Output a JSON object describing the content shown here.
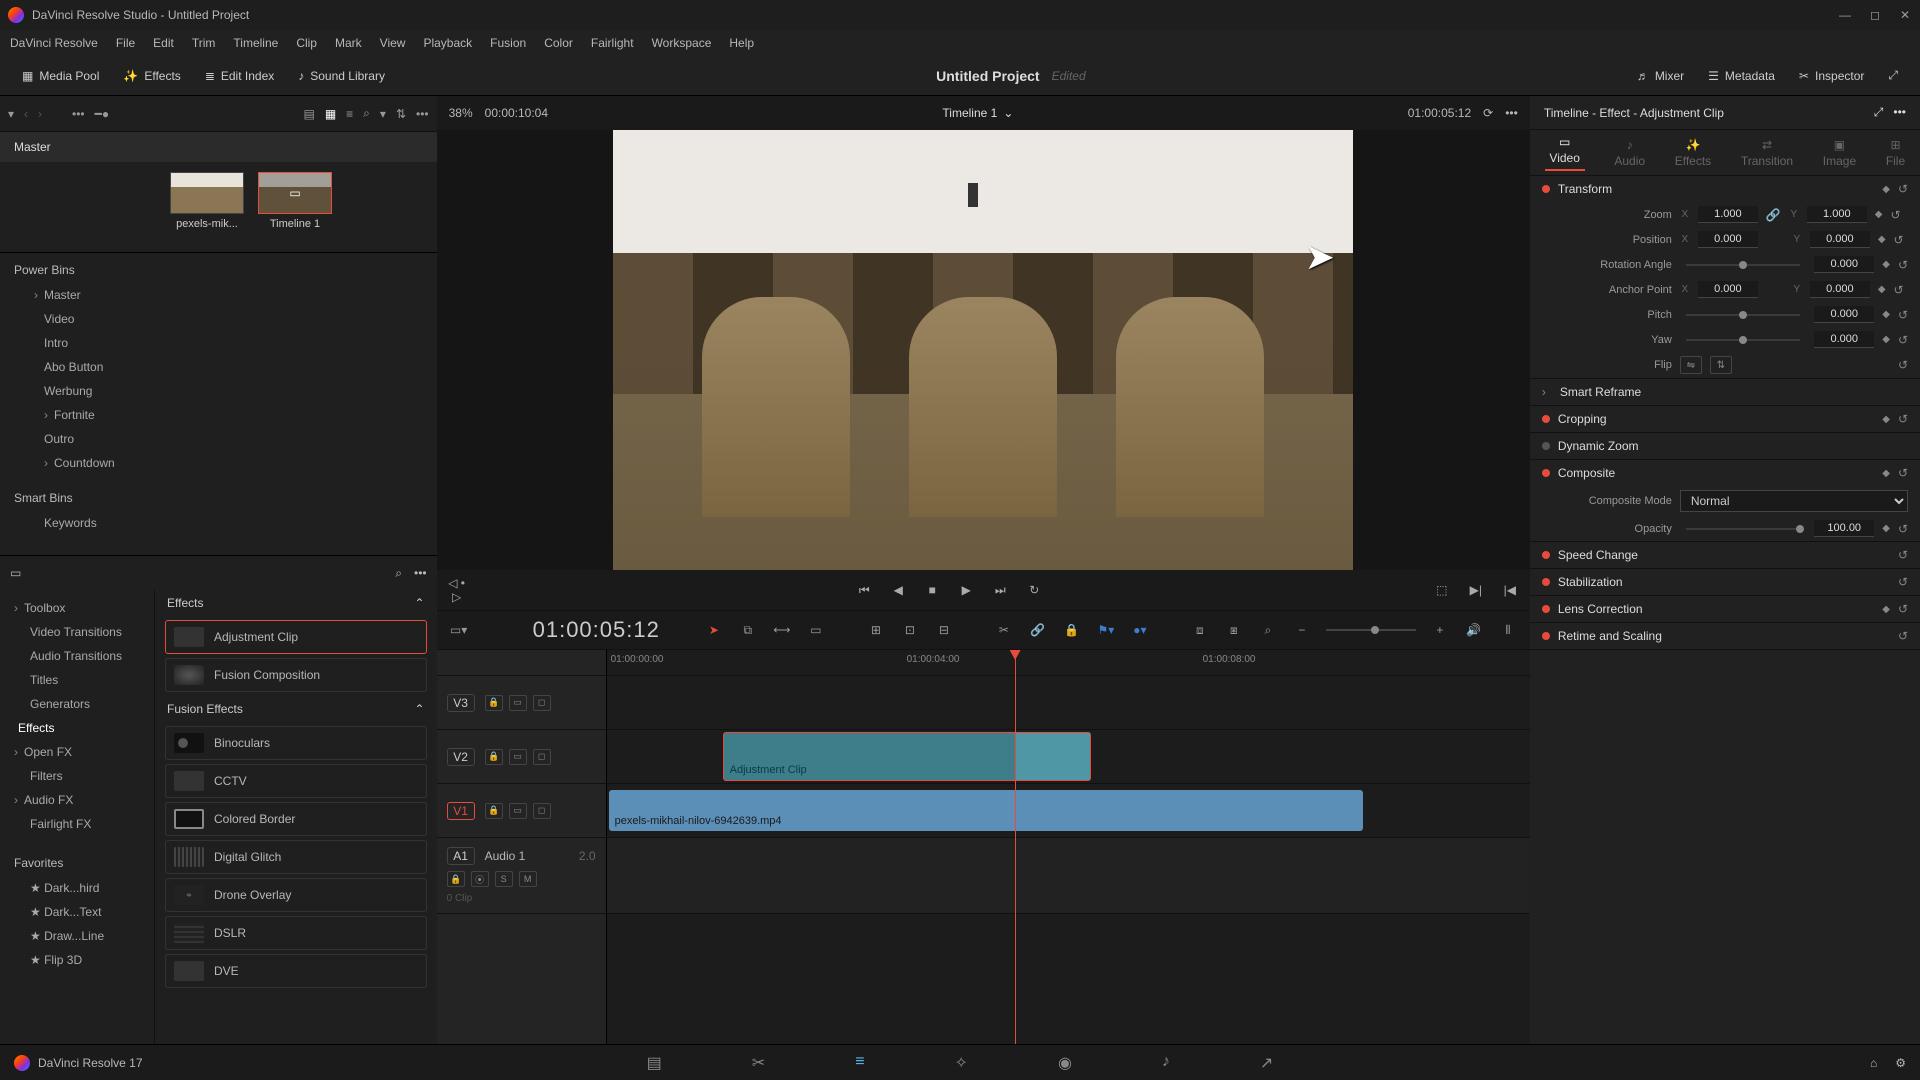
{
  "titlebar": {
    "title": "DaVinci Resolve Studio - Untitled Project"
  },
  "menu": [
    "DaVinci Resolve",
    "File",
    "Edit",
    "Trim",
    "Timeline",
    "Clip",
    "Mark",
    "View",
    "Playback",
    "Fusion",
    "Color",
    "Fairlight",
    "Workspace",
    "Help"
  ],
  "toolbar": {
    "media_pool": "Media Pool",
    "effects": "Effects",
    "edit_index": "Edit Index",
    "sound_library": "Sound Library",
    "project": "Untitled Project",
    "edited": "Edited",
    "mixer": "Mixer",
    "metadata": "Metadata",
    "inspector": "Inspector"
  },
  "media": {
    "master": "Master",
    "thumbs": [
      {
        "name": "pexels-mik..."
      },
      {
        "name": "Timeline 1"
      }
    ],
    "zoom_pct": "38%",
    "tc_left": "00:00:10:04"
  },
  "power_bins": {
    "header": "Power Bins",
    "master": "Master",
    "items": [
      "Video",
      "Intro",
      "Abo Button",
      "Werbung",
      "Fortnite",
      "Outro",
      "Countdown"
    ]
  },
  "smart_bins": {
    "header": "Smart Bins",
    "items": [
      "Keywords"
    ]
  },
  "fx_tree": {
    "toolbox": "Toolbox",
    "items": [
      "Video Transitions",
      "Audio Transitions",
      "Titles",
      "Generators",
      "Effects"
    ],
    "openfx": "Open FX",
    "filters": "Filters",
    "audiofx": "Audio FX",
    "fairlightfx": "Fairlight FX",
    "favorites": "Favorites",
    "fav_items": [
      "Dark...hird",
      "Dark...Text",
      "Draw...Line",
      "Flip 3D"
    ]
  },
  "fx_list": {
    "effects_header": "Effects",
    "items": [
      "Adjustment Clip",
      "Fusion Composition"
    ],
    "fusion_header": "Fusion Effects",
    "fusion_items": [
      "Binoculars",
      "CCTV",
      "Colored Border",
      "Digital Glitch",
      "Drone Overlay",
      "DSLR",
      "DVE"
    ]
  },
  "viewer": {
    "timeline_name": "Timeline 1",
    "tc_right": "01:00:05:12"
  },
  "timeline": {
    "tc": "01:00:05:12",
    "ruler": [
      "01:00:00:00",
      "01:00:04:00",
      "01:00:08:00"
    ],
    "tracks": {
      "v3": "V3",
      "v2": "V2",
      "v1": "V1",
      "a1": "A1",
      "a1_name": "Audio 1",
      "a1_ch": "2.0",
      "a1_sub": "0 Clip"
    },
    "clips": {
      "adj": "Adjustment Clip",
      "vid": "pexels-mikhail-nilov-6942639.mp4"
    }
  },
  "inspector": {
    "title": "Timeline - Effect - Adjustment Clip",
    "tabs": [
      "Video",
      "Audio",
      "Effects",
      "Transition",
      "Image",
      "File"
    ],
    "transform": {
      "header": "Transform",
      "zoom": "Zoom",
      "zoom_x": "1.000",
      "zoom_y": "1.000",
      "position": "Position",
      "pos_x": "0.000",
      "pos_y": "0.000",
      "rotation": "Rotation Angle",
      "rot_v": "0.000",
      "anchor": "Anchor Point",
      "anc_x": "0.000",
      "anc_y": "0.000",
      "pitch": "Pitch",
      "pitch_v": "0.000",
      "yaw": "Yaw",
      "yaw_v": "0.000",
      "flip": "Flip"
    },
    "smart_reframe": "Smart Reframe",
    "cropping": "Cropping",
    "dynamic_zoom": "Dynamic Zoom",
    "composite": {
      "header": "Composite",
      "mode_label": "Composite Mode",
      "mode": "Normal",
      "opacity_label": "Opacity",
      "opacity": "100.00"
    },
    "speed": "Speed Change",
    "stab": "Stabilization",
    "lens": "Lens Correction",
    "retime": "Retime and Scaling"
  },
  "bottombar": {
    "app": "DaVinci Resolve 17"
  }
}
